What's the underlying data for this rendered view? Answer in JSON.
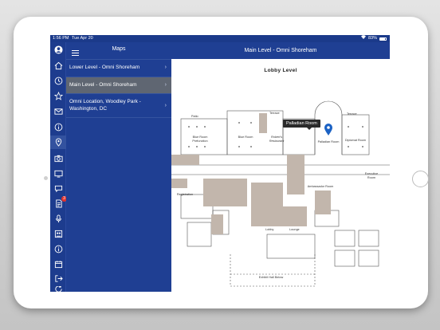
{
  "status": {
    "time": "1:56 PM",
    "date": "Tue Apr 20",
    "battery": "83%"
  },
  "rail": {
    "badge_count": "3",
    "icons": [
      "profile-icon",
      "home-icon",
      "clock-icon",
      "star-icon",
      "mail-icon",
      "info-icon",
      "map-pin-icon",
      "camera-icon",
      "video-icon",
      "chat-icon",
      "document-icon",
      "microphone-icon",
      "people-icon",
      "info-icon",
      "calendar-icon",
      "logout-icon",
      "refresh-icon"
    ]
  },
  "panel": {
    "title": "Maps",
    "items": [
      {
        "label": "Lower Level - Omni Shoreham"
      },
      {
        "label": "Main Level - Omni Shoreham"
      },
      {
        "label": "Omni Location, Woodley Park - Washington, DC"
      }
    ]
  },
  "main": {
    "title": "Main Level - Omni Shoreham"
  },
  "map": {
    "heading": "Lobby Level",
    "tooltip": "Palladian Room",
    "labels": {
      "patio": "Patio",
      "terrace1": "Terrace",
      "terrace2": "Terrace",
      "blue_pre": "Blue Room Prefunction",
      "blue": "Blue Room",
      "roberts": "Robert's Restaurant",
      "palladian": "Palladian Room",
      "diplomat": "Diplomat Room",
      "ambassador": "Ambassador Room",
      "executive": "Executive Room",
      "exhibit": "Exhibit Hall Below",
      "lobby": "Lobby",
      "lounge": "Lounge",
      "registration": "Registration"
    },
    "colors": {
      "brand": "#1f3f93",
      "floor": "#c2b6ac",
      "pin": "#1b62c4"
    }
  }
}
